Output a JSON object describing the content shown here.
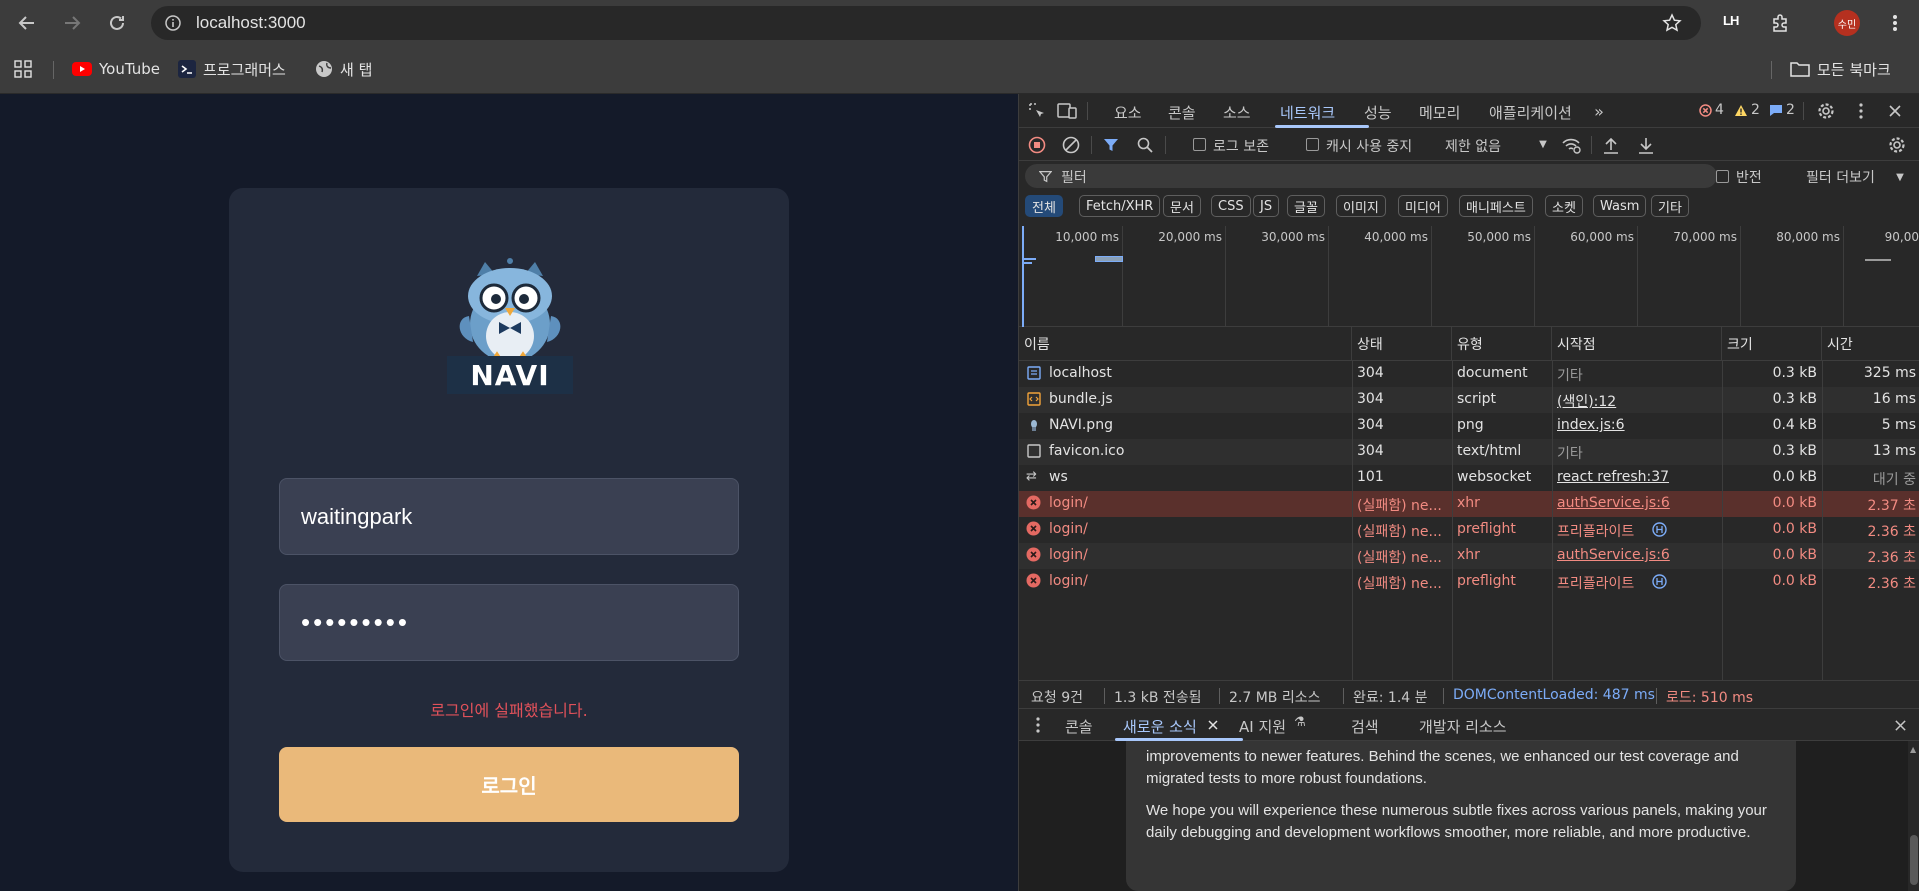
{
  "browser": {
    "url": "localhost:3000",
    "bookmarks": [
      {
        "label": "YouTube"
      },
      {
        "label": "프로그래머스"
      },
      {
        "label": "새 탭"
      }
    ],
    "all_bookmarks": "모든 북마크",
    "avatar_text": "수민",
    "ext_label": "LH"
  },
  "login": {
    "logo_text": "NAVI",
    "username": "waitingpark",
    "password_mask": "•••••••••",
    "error": "로그인에 실패했습니다.",
    "button": "로그인"
  },
  "devtools": {
    "tabs": [
      "요소",
      "콘솔",
      "소스",
      "네트워크",
      "성능",
      "메모리",
      "애플리케이션"
    ],
    "errors": "4",
    "warnings": "2",
    "messages": "2",
    "toolbar": {
      "preserve_log": "로그 보존",
      "disable_cache": "캐시 사용 중지",
      "throttle": "제한 없음"
    },
    "filter": {
      "placeholder": "필터",
      "invert": "반전",
      "more_filters": "필터 더보기"
    },
    "types": [
      "전체",
      "Fetch/XHR",
      "문서",
      "CSS",
      "JS",
      "글꼴",
      "이미지",
      "미디어",
      "매니페스트",
      "소켓",
      "Wasm",
      "기타"
    ],
    "timeline_labels": [
      "10,000 ms",
      "20,000 ms",
      "30,000 ms",
      "40,000 ms",
      "50,000 ms",
      "60,000 ms",
      "70,000 ms",
      "80,000 ms",
      "90,00"
    ],
    "columns": [
      "이름",
      "상태",
      "유형",
      "시작점",
      "크기",
      "시간"
    ],
    "rows": [
      {
        "name": "localhost",
        "status": "304",
        "type": "document",
        "initiator": "기타",
        "size": "0.3 kB",
        "time": "325 ms"
      },
      {
        "name": "bundle.js",
        "status": "304",
        "type": "script",
        "initiator": "(색인):12",
        "size": "0.3 kB",
        "time": "16 ms"
      },
      {
        "name": "NAVI.png",
        "status": "304",
        "type": "png",
        "initiator": "index.js:6",
        "size": "0.4 kB",
        "time": "5 ms"
      },
      {
        "name": "favicon.ico",
        "status": "304",
        "type": "text/html",
        "initiator": "기타",
        "size": "0.3 kB",
        "time": "13 ms"
      },
      {
        "name": "ws",
        "status": "101",
        "type": "websocket",
        "initiator": "react refresh:37",
        "size": "0.0 kB",
        "time": "대기 중"
      },
      {
        "name": "login/",
        "status": "(실패함) ne...",
        "type": "xhr",
        "initiator": "authService.js:6",
        "size": "0.0 kB",
        "time": "2.37 초"
      },
      {
        "name": "login/",
        "status": "(실패함) ne...",
        "type": "preflight",
        "initiator": "프리플라이트",
        "size": "0.0 kB",
        "time": "2.36 초"
      },
      {
        "name": "login/",
        "status": "(실패함) ne...",
        "type": "xhr",
        "initiator": "authService.js:6",
        "size": "0.0 kB",
        "time": "2.36 초"
      },
      {
        "name": "login/",
        "status": "(실패함) ne...",
        "type": "preflight",
        "initiator": "프리플라이트",
        "size": "0.0 kB",
        "time": "2.36 초"
      }
    ],
    "status_bar": {
      "requests": "요청 9건",
      "transferred": "1.3 kB 전송됨",
      "resources": "2.7 MB 리소스",
      "finish": "완료: 1.4 분",
      "dcl": "DOMContentLoaded: 487 ms",
      "load": "로드: 510 ms"
    },
    "drawer_tabs": [
      "콘솔",
      "새로운 소식",
      "AI 지원",
      "검색",
      "개발자 리소스"
    ],
    "news": [
      "improvements to newer features. Behind the scenes, we enhanced our test coverage and migrated tests to more robust foundations.",
      "We hope you will experience these numerous subtle fixes across various panels, making your daily debugging and development workflows smoother, more reliable, and more productive."
    ]
  }
}
